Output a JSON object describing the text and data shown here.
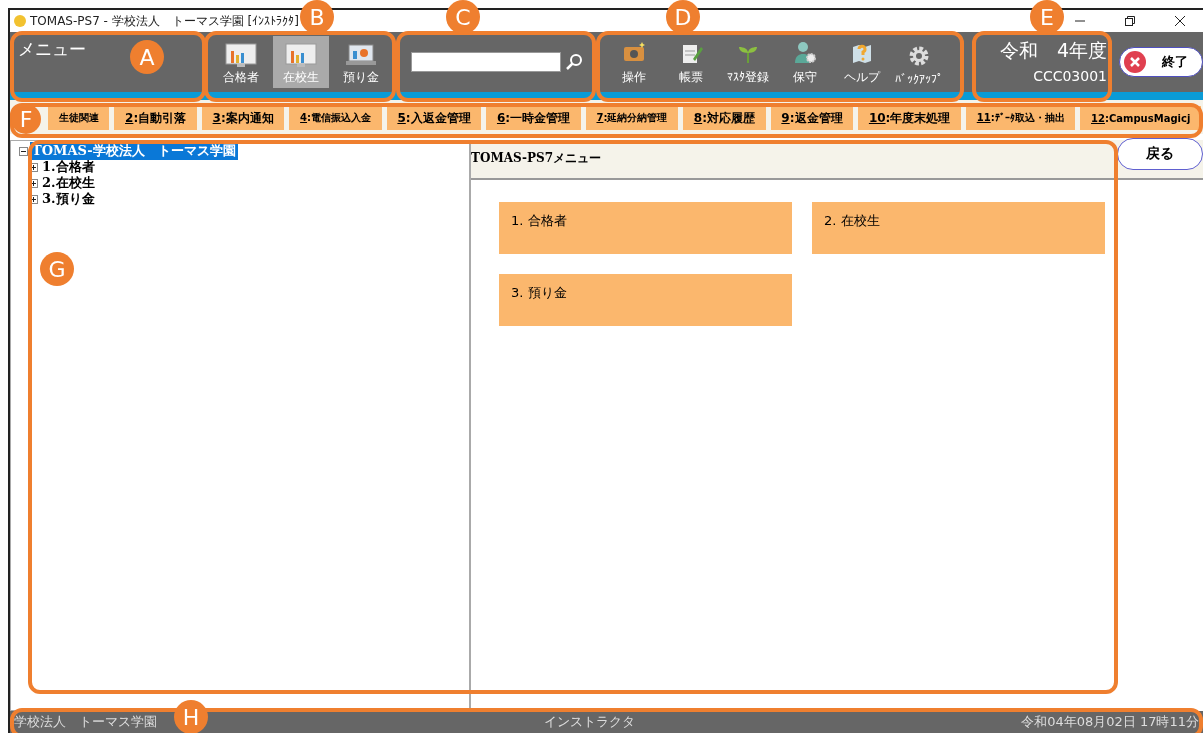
{
  "window": {
    "title": "TOMAS-PS7 - 学校法人　トーマス学園 [ｲﾝｽﾄﾗｸﾀ]"
  },
  "header": {
    "label": "メニュー"
  },
  "modes": [
    {
      "label": "合格者",
      "selected": false
    },
    {
      "label": "在校生",
      "selected": true
    },
    {
      "label": "預り金",
      "selected": false
    }
  ],
  "tools": [
    {
      "label": "操作",
      "kind": "camera"
    },
    {
      "label": "帳票",
      "kind": "note"
    },
    {
      "label": "ﾏｽﾀ登録",
      "kind": "sprout"
    },
    {
      "label": "保守",
      "kind": "person"
    },
    {
      "label": "ヘルプ",
      "kind": "help"
    },
    {
      "label": "ﾊﾞｯｸｱｯﾌﾟ",
      "kind": "gear"
    }
  ],
  "era": {
    "year": "令和　4年度",
    "code": "CCC03001"
  },
  "exit_button": {
    "label": "終了"
  },
  "tabs": [
    {
      "label": "生徒関連",
      "small": true
    },
    {
      "key": "2",
      "label": ":自動引落"
    },
    {
      "key": "3",
      "label": ":案内通知"
    },
    {
      "key": "4",
      "label": ":電信振込入金",
      "small": true
    },
    {
      "key": "5",
      "label": ":入返金管理"
    },
    {
      "key": "6",
      "label": ":一時金管理"
    },
    {
      "key": "7",
      "label": ":延納分納管理",
      "small": true
    },
    {
      "key": "8",
      "label": ":対応履歴"
    },
    {
      "key": "9",
      "label": ":返金管理"
    },
    {
      "key": "10",
      "label": ":年度末処理"
    },
    {
      "key": "11",
      "label": ":ﾃﾞｰﾀ取込・抽出",
      "small": true
    },
    {
      "key": "12",
      "label": ":CampusMagicj",
      "small": true
    }
  ],
  "tree": [
    {
      "label": "TOMAS-学校法人　トーマス学園",
      "selected": true,
      "expanded": true,
      "children": [
        {
          "label": "1.合格者",
          "selected": false,
          "expanded": false
        },
        {
          "label": "2.在校生",
          "selected": false,
          "expanded": false
        },
        {
          "label": "3.預り金",
          "selected": false,
          "expanded": false
        }
      ]
    }
  ],
  "panel": {
    "title": "TOMAS-PS7メニュー",
    "back_button": "戻る",
    "tiles": [
      "1. 合格者",
      "2. 在校生",
      "3. 預り金"
    ]
  },
  "status_bar": {
    "left": "学校法人　トーマス学園",
    "center": "インストラクタ",
    "right": "令和04年08月02日 17時11分"
  },
  "annotations": [
    {
      "label": "A"
    },
    {
      "label": "B"
    },
    {
      "label": "C"
    },
    {
      "label": "D"
    },
    {
      "label": "E"
    },
    {
      "label": "F"
    },
    {
      "label": "G"
    },
    {
      "label": "H"
    }
  ]
}
